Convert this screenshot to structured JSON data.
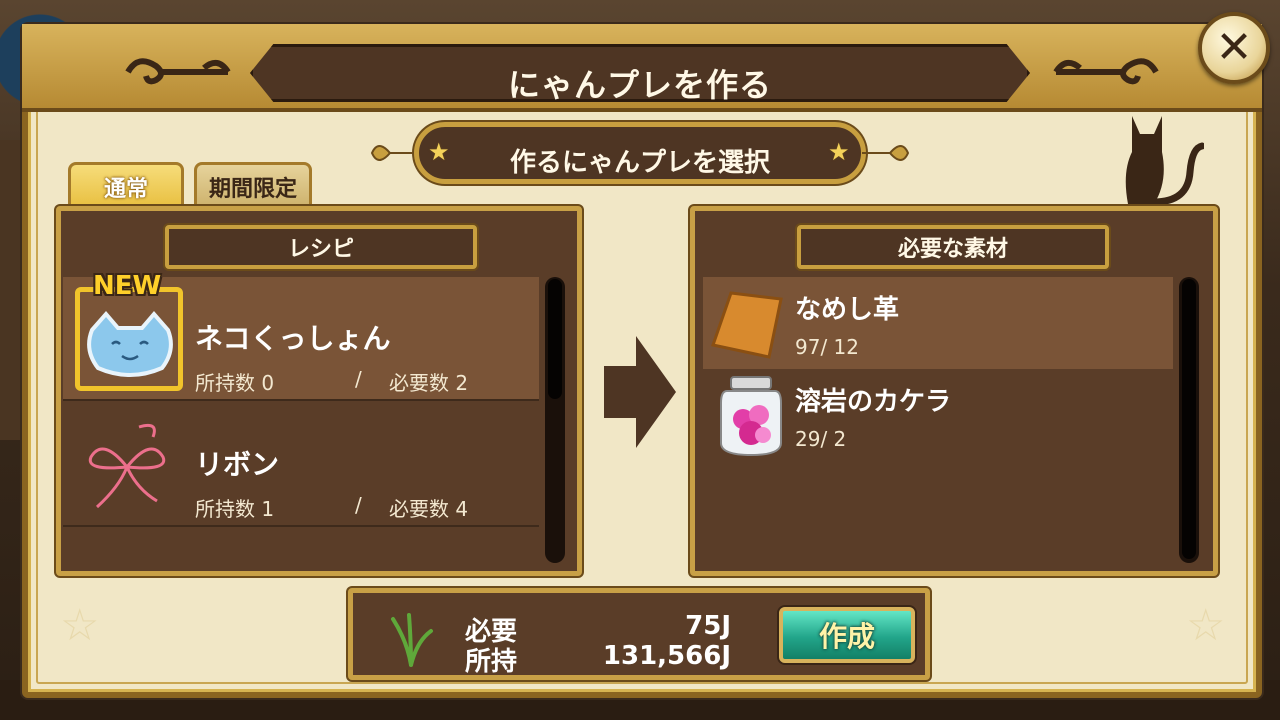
{
  "title": "にゃんプレを作る",
  "subtitle": "作るにゃんプレを選択",
  "tabs": [
    {
      "label": "通常",
      "active": true
    },
    {
      "label": "期間限定",
      "active": false
    }
  ],
  "recipe_panel": {
    "header": "レシピ",
    "items": [
      {
        "name": "ネコくっしょん",
        "owned": "所持数 0",
        "separator": "/",
        "required": "必要数 2",
        "badge": "NEW",
        "icon": "cat-cushion-icon",
        "selected": true
      },
      {
        "name": "リボン",
        "owned": "所持数 1",
        "separator": "/",
        "required": "必要数 4",
        "icon": "ribbon-icon",
        "selected": false
      }
    ]
  },
  "materials_panel": {
    "header": "必要な素材",
    "items": [
      {
        "name": "なめし革",
        "count": "97/ 12",
        "icon": "leather-icon",
        "selected": true
      },
      {
        "name": "溶岩のカケラ",
        "count": "29/ 2",
        "icon": "lava-jar-icon",
        "selected": false
      }
    ]
  },
  "cost": {
    "required_label": "必要",
    "required_value": "75J",
    "owned_label": "所持",
    "owned_value": "131,566J",
    "make_button": "作成"
  },
  "colors": {
    "panel": "#5a3d28",
    "frame": "#c8a046",
    "accent_button": "#22a58a",
    "new_badge": "#ffd02a"
  }
}
